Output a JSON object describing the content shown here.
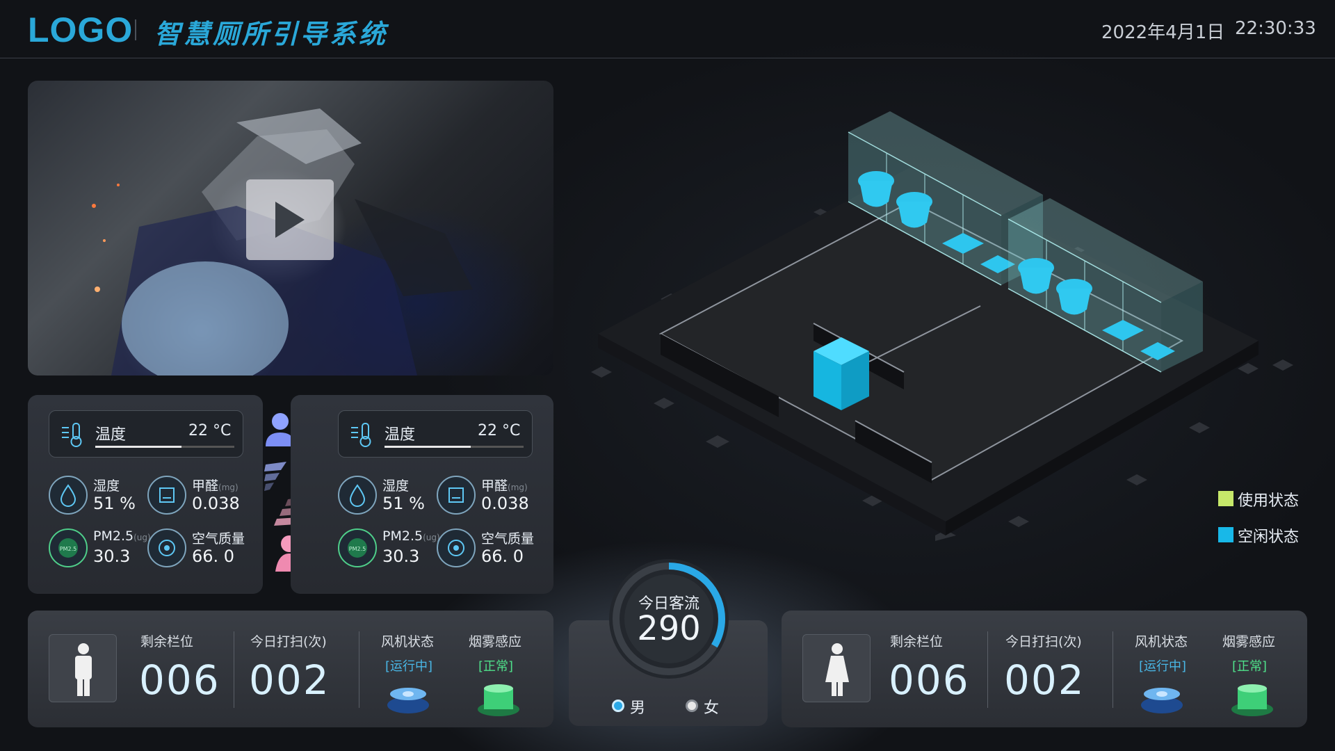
{
  "header": {
    "logo": "LOGO",
    "title": "智慧厕所引导系统",
    "date": "2022年4月1日",
    "time": "22:30:33"
  },
  "sensors_male": {
    "temperature_label": "温度",
    "temperature_value": "22 °C",
    "humidity_label": "湿度",
    "humidity_value": "51 %",
    "formaldehyde_label": "甲醛",
    "formaldehyde_unit": "(mg)",
    "formaldehyde_value": "0.038",
    "pm25_label": "PM2.5",
    "pm25_unit": "(ug)",
    "pm25_value": "30.3",
    "air_quality_label": "空气质量",
    "air_quality_value": "66. 0"
  },
  "sensors_female": {
    "temperature_label": "温度",
    "temperature_value": "22 °C",
    "humidity_label": "湿度",
    "humidity_value": "51 %",
    "formaldehyde_label": "甲醛",
    "formaldehyde_unit": "(mg)",
    "formaldehyde_value": "0.038",
    "pm25_label": "PM2.5",
    "pm25_unit": "(ug)",
    "pm25_value": "30.3",
    "air_quality_label": "空气质量",
    "air_quality_value": "66. 0"
  },
  "legend": {
    "in_use": "使用状态",
    "in_use_color": "#c6e86a",
    "idle": "空闲状态",
    "idle_color": "#18b8e8"
  },
  "male_stats": {
    "remaining_label": "剩余栏位",
    "remaining_value": "006",
    "cleaning_label": "今日打扫(次)",
    "cleaning_value": "002",
    "fan_label": "风机状态",
    "fan_status": "[运行中]",
    "smoke_label": "烟雾感应",
    "smoke_status": "[正常]"
  },
  "female_stats": {
    "remaining_label": "剩余栏位",
    "remaining_value": "006",
    "cleaning_label": "今日打扫(次)",
    "cleaning_value": "002",
    "fan_label": "风机状态",
    "fan_status": "[运行中]",
    "smoke_label": "烟雾感应",
    "smoke_status": "[正常]"
  },
  "flow": {
    "title": "今日客流",
    "value": "290",
    "male_label": "男",
    "female_label": "女",
    "male_color": "#2aa8e6",
    "female_color": "#e8e8e8"
  },
  "video": {
    "play_icon": "play-icon"
  }
}
